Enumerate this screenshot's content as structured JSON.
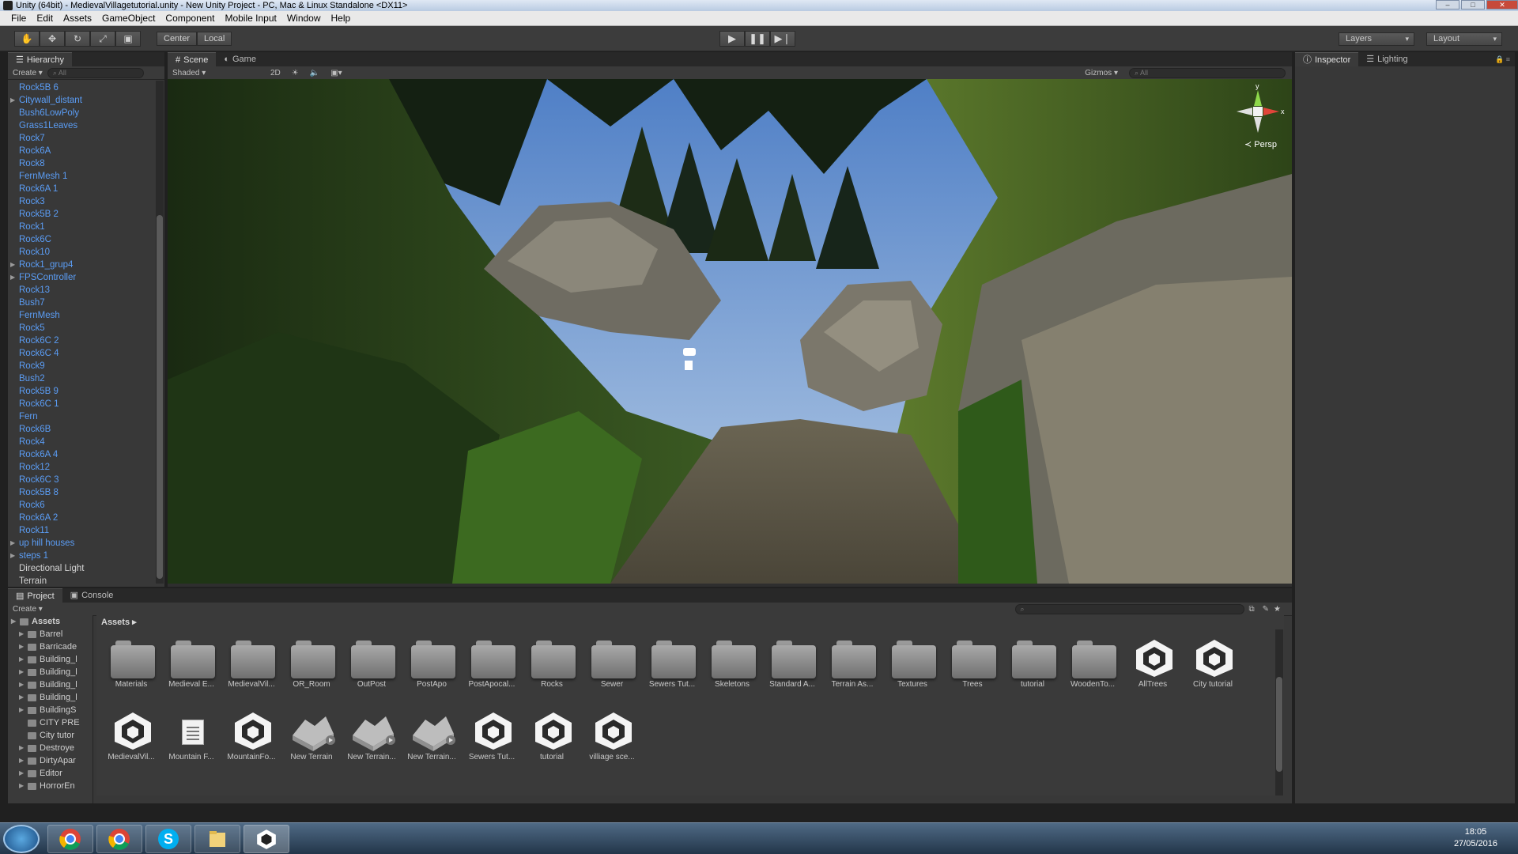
{
  "window": {
    "title": "Unity (64bit) - MedievalVillagetutorial.unity - New Unity Project - PC, Mac & Linux Standalone <DX11>"
  },
  "menu": [
    "File",
    "Edit",
    "Assets",
    "GameObject",
    "Component",
    "Mobile Input",
    "Window",
    "Help"
  ],
  "toolbar": {
    "center_label": "Center",
    "local_label": "Local",
    "layers_label": "Layers",
    "layout_label": "Layout"
  },
  "hierarchy": {
    "tab": "Hierarchy",
    "create": "Create",
    "search": "All",
    "items": [
      {
        "label": "Rock5B 6",
        "arrow": false,
        "color": "blue"
      },
      {
        "label": "Citywall_distant",
        "arrow": true,
        "color": "blue"
      },
      {
        "label": "Bush6LowPoly",
        "arrow": false,
        "color": "blue"
      },
      {
        "label": "Grass1Leaves",
        "arrow": false,
        "color": "blue"
      },
      {
        "label": "Rock7",
        "arrow": false,
        "color": "blue"
      },
      {
        "label": "Rock6A",
        "arrow": false,
        "color": "blue"
      },
      {
        "label": "Rock8",
        "arrow": false,
        "color": "blue"
      },
      {
        "label": "FernMesh 1",
        "arrow": false,
        "color": "blue"
      },
      {
        "label": "Rock6A 1",
        "arrow": false,
        "color": "blue"
      },
      {
        "label": "Rock3",
        "arrow": false,
        "color": "blue"
      },
      {
        "label": "Rock5B 2",
        "arrow": false,
        "color": "blue"
      },
      {
        "label": "Rock1",
        "arrow": false,
        "color": "blue"
      },
      {
        "label": "Rock6C",
        "arrow": false,
        "color": "blue"
      },
      {
        "label": "Rock10",
        "arrow": false,
        "color": "blue"
      },
      {
        "label": "Rock1_grup4",
        "arrow": true,
        "color": "blue"
      },
      {
        "label": "FPSController",
        "arrow": true,
        "color": "blue"
      },
      {
        "label": "Rock13",
        "arrow": false,
        "color": "blue"
      },
      {
        "label": "Bush7",
        "arrow": false,
        "color": "blue"
      },
      {
        "label": "FernMesh",
        "arrow": false,
        "color": "blue"
      },
      {
        "label": "Rock5",
        "arrow": false,
        "color": "blue"
      },
      {
        "label": "Rock6C 2",
        "arrow": false,
        "color": "blue"
      },
      {
        "label": "Rock6C 4",
        "arrow": false,
        "color": "blue"
      },
      {
        "label": "Rock9",
        "arrow": false,
        "color": "blue"
      },
      {
        "label": "Bush2",
        "arrow": false,
        "color": "blue"
      },
      {
        "label": "Rock5B 9",
        "arrow": false,
        "color": "blue"
      },
      {
        "label": "Rock6C 1",
        "arrow": false,
        "color": "blue"
      },
      {
        "label": "Fern",
        "arrow": false,
        "color": "blue"
      },
      {
        "label": "Rock6B",
        "arrow": false,
        "color": "blue"
      },
      {
        "label": "Rock4",
        "arrow": false,
        "color": "blue"
      },
      {
        "label": "Rock6A 4",
        "arrow": false,
        "color": "blue"
      },
      {
        "label": "Rock12",
        "arrow": false,
        "color": "blue"
      },
      {
        "label": "Rock6C 3",
        "arrow": false,
        "color": "blue"
      },
      {
        "label": "Rock5B 8",
        "arrow": false,
        "color": "blue"
      },
      {
        "label": "Rock6",
        "arrow": false,
        "color": "blue"
      },
      {
        "label": "Rock6A 2",
        "arrow": false,
        "color": "blue"
      },
      {
        "label": "Rock11",
        "arrow": false,
        "color": "blue"
      },
      {
        "label": "up hill houses",
        "arrow": true,
        "color": "blue"
      },
      {
        "label": "steps 1",
        "arrow": true,
        "color": "blue"
      },
      {
        "label": "Directional Light",
        "arrow": false,
        "color": "plain"
      },
      {
        "label": "Terrain",
        "arrow": false,
        "color": "plain"
      }
    ]
  },
  "scene": {
    "tab_scene": "Scene",
    "tab_game": "Game",
    "shaded": "Shaded",
    "mode_2d": "2D",
    "gizmos": "Gizmos",
    "search": "All",
    "persp": "Persp",
    "axis_x": "x",
    "axis_y": "y"
  },
  "inspector": {
    "tab_inspector": "Inspector",
    "tab_lighting": "Lighting"
  },
  "project": {
    "tab_project": "Project",
    "tab_console": "Console",
    "create": "Create",
    "breadcrumb": "Assets",
    "tree": [
      {
        "label": "Assets",
        "level": 0,
        "arrow": true,
        "bold": true
      },
      {
        "label": "Barrel",
        "level": 1,
        "arrow": true
      },
      {
        "label": "Barricade",
        "level": 1,
        "arrow": true
      },
      {
        "label": "Building_l",
        "level": 1,
        "arrow": true
      },
      {
        "label": "Building_l",
        "level": 1,
        "arrow": true
      },
      {
        "label": "Building_l",
        "level": 1,
        "arrow": true
      },
      {
        "label": "Building_l",
        "level": 1,
        "arrow": true
      },
      {
        "label": "BuildingS",
        "level": 1,
        "arrow": true
      },
      {
        "label": "CITY PRE",
        "level": 1,
        "arrow": false
      },
      {
        "label": "City tutor",
        "level": 1,
        "arrow": false
      },
      {
        "label": "Destroye",
        "level": 1,
        "arrow": true
      },
      {
        "label": "DirtyApar",
        "level": 1,
        "arrow": true
      },
      {
        "label": "Editor",
        "level": 1,
        "arrow": true
      },
      {
        "label": "HorrorEn",
        "level": 1,
        "arrow": true
      }
    ],
    "assets": [
      {
        "label": "Materials",
        "type": "folder"
      },
      {
        "label": "Medieval E...",
        "type": "folder"
      },
      {
        "label": "MedievalVil...",
        "type": "folder"
      },
      {
        "label": "OR_Room",
        "type": "folder"
      },
      {
        "label": "OutPost",
        "type": "folder"
      },
      {
        "label": "PostApo",
        "type": "folder"
      },
      {
        "label": "PostApocal...",
        "type": "folder"
      },
      {
        "label": "Rocks",
        "type": "folder"
      },
      {
        "label": "Sewer",
        "type": "folder"
      },
      {
        "label": "Sewers Tut...",
        "type": "folder"
      },
      {
        "label": "Skeletons",
        "type": "folder"
      },
      {
        "label": "Standard A...",
        "type": "folder"
      },
      {
        "label": "Terrain As...",
        "type": "folder"
      },
      {
        "label": "Textures",
        "type": "folder"
      },
      {
        "label": "Trees",
        "type": "folder"
      },
      {
        "label": "tutorial",
        "type": "folder"
      },
      {
        "label": "WoodenTo...",
        "type": "folder"
      },
      {
        "label": "AllTrees",
        "type": "unity"
      },
      {
        "label": "City tutorial",
        "type": "unity"
      },
      {
        "label": "MedievalVil...",
        "type": "unity"
      },
      {
        "label": "Mountain F...",
        "type": "doc"
      },
      {
        "label": "MountainFo...",
        "type": "unity"
      },
      {
        "label": "New Terrain",
        "type": "terrain"
      },
      {
        "label": "New Terrain...",
        "type": "terrain"
      },
      {
        "label": "New Terrain...",
        "type": "terrain"
      },
      {
        "label": "Sewers Tut...",
        "type": "unity"
      },
      {
        "label": "tutorial",
        "type": "unity"
      },
      {
        "label": "villiage sce...",
        "type": "unity"
      }
    ]
  },
  "taskbar": {
    "time": "18:05",
    "date": "27/05/2016",
    "apps": [
      "chrome-icon",
      "chrome-icon",
      "skype-icon",
      "folder-icon",
      "unity-icon"
    ]
  },
  "colors": {
    "link_blue": "#5b9df5",
    "panel": "#383838",
    "sky": "#6f9bd8"
  }
}
